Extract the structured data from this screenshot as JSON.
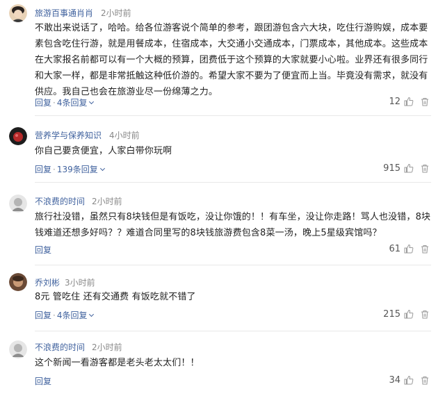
{
  "comments": [
    {
      "username": "旅游百事通肖肖",
      "time": "2小时前",
      "text": "不敢出来说话了，哈哈。给各位游客说个简单的参考，跟团游包含六大块，吃住行游购娱，成本要素包含吃住行游，就是用餐成本，住宿成本，大交通小交通成本，门票成本，其他成本。这些成本在大家报名前都可以有一个大概的预算，团费低于这个预算的大家就要小心啦。业界还有很多同行和大家一样，都是非常抵触这种低价游的。希望大家不要为了便宜而上当。毕竟没有需求，就没有供应。我自己也会在旅游业尽一份绵薄之力。",
      "reply_label": "回复",
      "sep": "·",
      "reply_count": "4条回复",
      "likes": "12"
    },
    {
      "username": "营养学与保养知识",
      "time": "4小时前",
      "text": "你自己要贪便宜，人家白带你玩啊",
      "reply_label": "回复",
      "sep": "·",
      "reply_count": "139条回复",
      "likes": "915"
    },
    {
      "username": "不浪费的时间",
      "time": "2小时前",
      "text": "旅行社没错，虽然只有8块钱但是有饭吃，没让你饿的！！有车坐，没让你走路！骂人也没错，8块钱难道还想多好吗？？难道合同里写的8块钱旅游费包含8菜一汤，晚上5星级宾馆吗？",
      "reply_label": "回复",
      "likes": "61"
    },
    {
      "username": "乔刘彬",
      "time": "3小时前",
      "text": "8元 管吃住 还有交通费 有饭吃就不错了",
      "reply_label": "回复",
      "sep": "·",
      "reply_count": "4条回复",
      "likes": "215"
    },
    {
      "username": "不浪费的时间",
      "time": "2小时前",
      "text": "这个新闻一看游客都是老头老太太们！！",
      "reply_label": "回复",
      "likes": "34"
    }
  ],
  "colors": {
    "link": "#40629e",
    "meta": "#888888",
    "text": "#222222",
    "divider": "#e8e8e8"
  },
  "icons": [
    "thumbs-up-icon",
    "trash-icon",
    "chevron-down-icon"
  ]
}
